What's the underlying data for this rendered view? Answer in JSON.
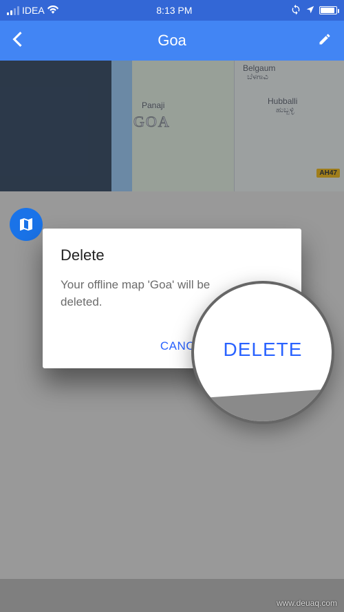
{
  "statusbar": {
    "carrier": "IDEA",
    "time": "8:13 PM",
    "locationIcon": "location-arrow",
    "batteryFull": true
  },
  "navbar": {
    "backIcon": "chevron-left",
    "title": "Goa",
    "editIcon": "pencil"
  },
  "map": {
    "labels": {
      "belgaum": "Belgaum",
      "belgaum_native": "ಬೆಳಗಾವಿ",
      "panaji": "Panaji",
      "goa": "GOA",
      "hubballi": "Hubballi",
      "hubballi_native": "ಹುಬ್ಬಳ್ಳಿ",
      "road": "AH47"
    }
  },
  "badge": {
    "icon": "map"
  },
  "dialog": {
    "title": "Delete",
    "message": "Your offline map 'Goa' will be deleted.",
    "cancel": "CANCEL",
    "confirm": "DELETE"
  },
  "callout": {
    "label": "DELETE"
  },
  "watermark": "www.deuaq.com",
  "colors": {
    "blue_header": "#4285f4",
    "deep_blue": "#3367d6",
    "accent": "#2962ff"
  }
}
